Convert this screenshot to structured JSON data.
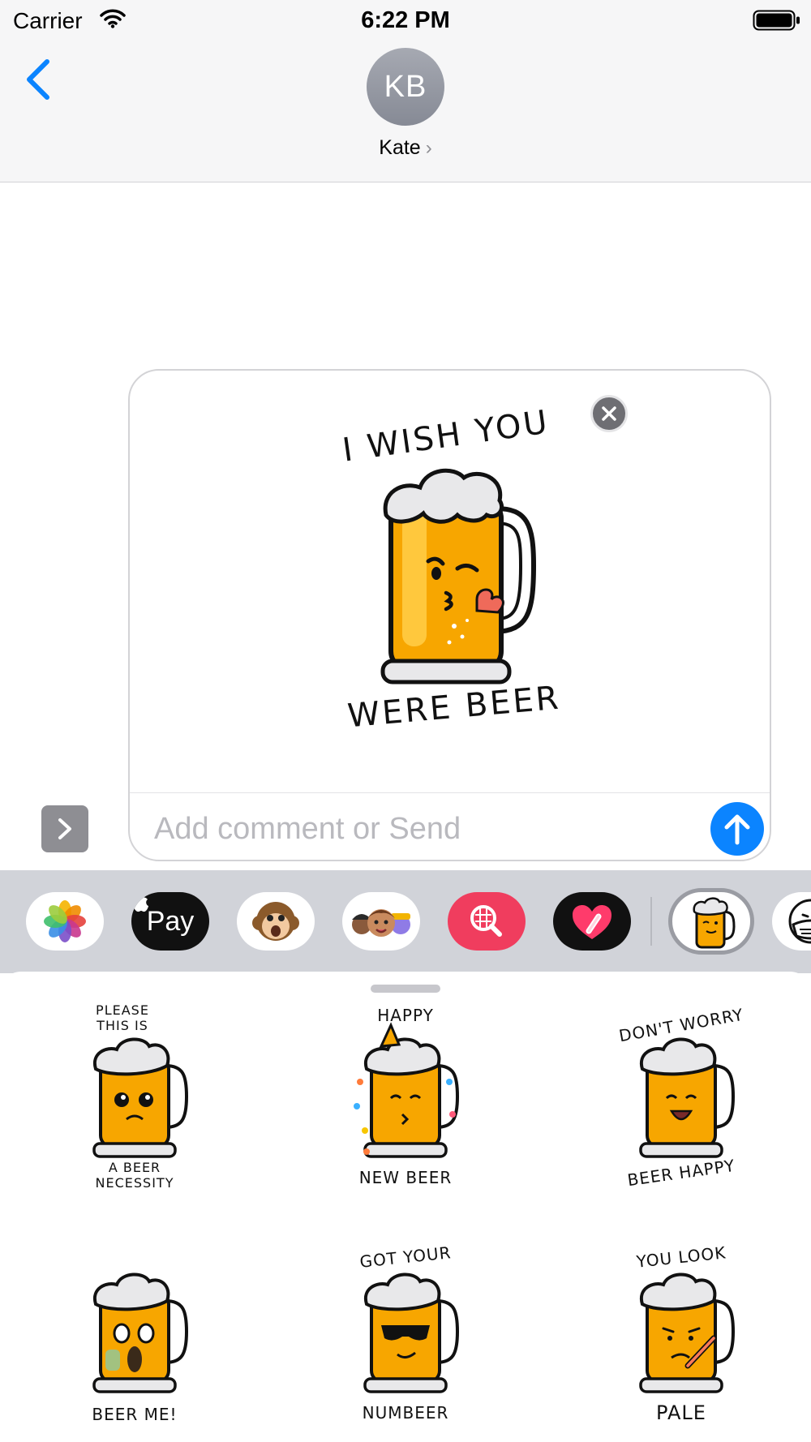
{
  "status_bar": {
    "carrier": "Carrier",
    "time": "6:22 PM"
  },
  "conversation": {
    "avatar_initials": "KB",
    "contact_name": "Kate"
  },
  "compose": {
    "sticker": {
      "text_top": "I WISH YOU",
      "text_bottom": "WERE BEER"
    },
    "comment_placeholder": "Add comment or Send",
    "comment_value": ""
  },
  "app_strip": {
    "apps": [
      {
        "name": "photos-icon"
      },
      {
        "name": "apple-pay-icon",
        "label": "Pay"
      },
      {
        "name": "animoji-monkey-icon"
      },
      {
        "name": "memoji-icon"
      },
      {
        "name": "image-search-icon"
      },
      {
        "name": "digital-touch-icon"
      },
      {
        "name": "beer-stickers-icon",
        "selected": true
      },
      {
        "name": "mask-sticker-icon"
      }
    ]
  },
  "stickers": [
    {
      "top": "PLEASE\nTHIS IS",
      "bottom": "A BEER\nNECESSITY"
    },
    {
      "top": "HAPPY",
      "bottom": "NEW BEER"
    },
    {
      "top": "DON'T WORRY",
      "bottom": "BEER HAPPY"
    },
    {
      "top": "",
      "bottom": "BEER ME!"
    },
    {
      "top": "GOT YOUR",
      "bottom": "NUMBEER"
    },
    {
      "top": "YOU LOOK",
      "bottom": "PALE"
    }
  ],
  "colors": {
    "accent": "#0b84ff",
    "beer": "#f7a600",
    "foam": "#e8e8ea",
    "header_bg": "#f6f6f7",
    "strip_bg": "#d1d3d9"
  }
}
